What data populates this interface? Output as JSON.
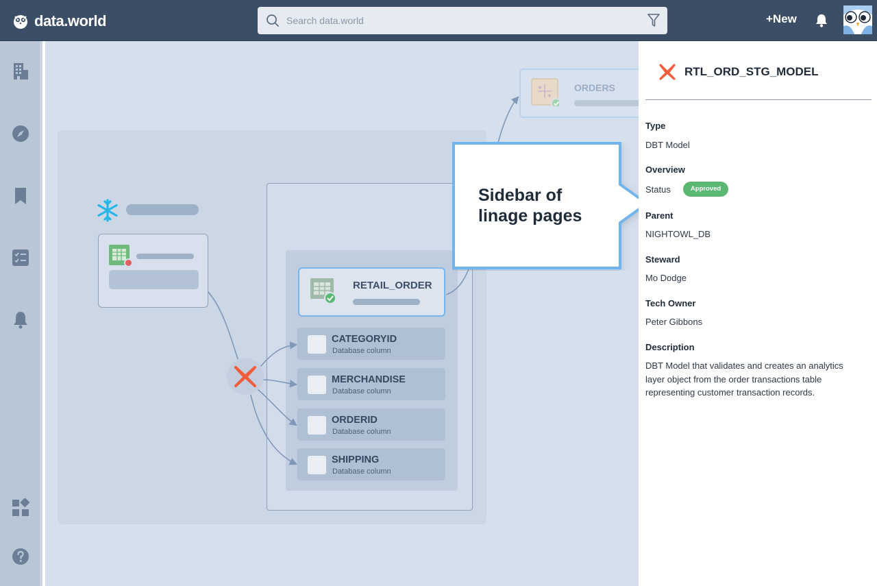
{
  "brand": {
    "name": "data.world"
  },
  "search": {
    "placeholder": "Search data.world"
  },
  "header": {
    "new_label": "+New"
  },
  "lineage": {
    "retail_order": {
      "name": "RETAIL_ORDER"
    },
    "orders": {
      "name": "ORDERS"
    },
    "columns": [
      {
        "name": "CATEGORYID",
        "type": "Database column"
      },
      {
        "name": "MERCHANDISE",
        "type": "Database column"
      },
      {
        "name": "ORDERID",
        "type": "Database column"
      },
      {
        "name": "SHIPPING",
        "type": "Database column"
      }
    ]
  },
  "callout": {
    "line1": "Sidebar of",
    "line2": "linage pages"
  },
  "sidebar": {
    "title": "RTL_ORD_STG_MODEL",
    "type_label": "Type",
    "type_value": "DBT Model",
    "overview_label": "Overview",
    "status_label": "Status",
    "status_badge": "Approved",
    "parent_label": "Parent",
    "parent_value": "NIGHTOWL_DB",
    "steward_label": "Steward",
    "steward_value": "Mo Dodge",
    "tech_owner_label": "Tech Owner",
    "tech_owner_value": "Peter Gibbons",
    "description_label": "Description",
    "description_value": "DBT Model that validates and creates an analytics layer object from the order transactions table representing customer transaction records."
  },
  "colors": {
    "topbar": "#3b4e66",
    "accent_blue": "#6fb4ee",
    "dbt_orange": "#f05c3c",
    "approved_green": "#5ab872",
    "snowflake_blue": "#29b5e8"
  },
  "icons": {
    "rail": [
      "building-icon",
      "compass-icon",
      "bookmark-icon",
      "checklist-icon",
      "bell-icon",
      "apps-icon",
      "help-icon"
    ],
    "top": [
      "search-icon",
      "filter-icon",
      "bell-icon",
      "avatar"
    ]
  }
}
